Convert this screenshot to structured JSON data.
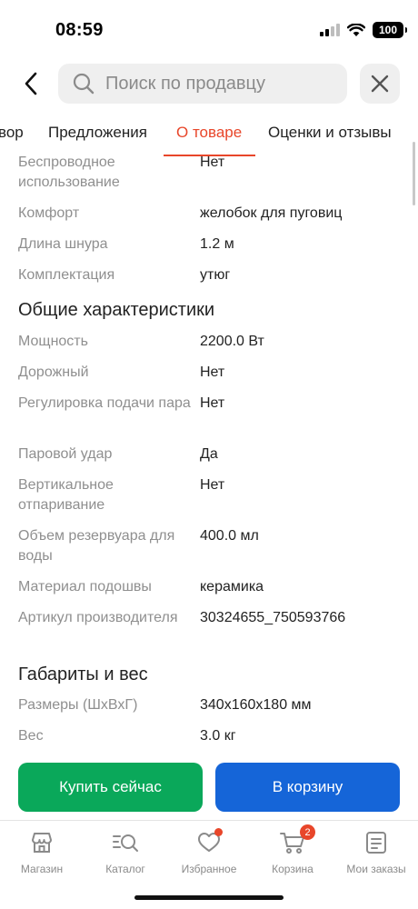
{
  "status": {
    "time": "08:59",
    "battery": "100"
  },
  "header": {
    "search_placeholder": "Поиск по продавцу"
  },
  "tabs": [
    {
      "label": "вор"
    },
    {
      "label": "Предложения"
    },
    {
      "label": "О товаре",
      "active": true
    },
    {
      "label": "Оценки и отзывы"
    }
  ],
  "specs_top": [
    {
      "key": "Беспроводное использование",
      "value": "Нет"
    },
    {
      "key": "Комфорт",
      "value": "желобок для пуговиц"
    },
    {
      "key": "Длина шнура",
      "value": "1.2 м"
    },
    {
      "key": "Комплектация",
      "value": "утюг"
    }
  ],
  "section_general": {
    "title": "Общие характеристики",
    "rows": [
      {
        "key": "Мощность",
        "value": "2200.0 Вт"
      },
      {
        "key": "Дорожный",
        "value": "Нет"
      },
      {
        "key": "Регулировка подачи пара",
        "value": "Нет"
      },
      {
        "key": "Паровой удар",
        "value": "Да"
      },
      {
        "key": "Вертикальное отпаривание",
        "value": "Нет"
      },
      {
        "key": "Объем резервуара для воды",
        "value": "400.0 мл"
      },
      {
        "key": "Материал подошвы",
        "value": "керамика"
      },
      {
        "key": "Артикул производителя",
        "value": "30324655_750593766"
      }
    ]
  },
  "section_dimensions": {
    "title": "Габариты и вес",
    "rows": [
      {
        "key": "Размеры (ШхВхГ)",
        "value": "340x160x180 мм"
      },
      {
        "key": "Вес",
        "value": "3.0 кг"
      }
    ]
  },
  "actions": {
    "buy_label": "Купить сейчас",
    "cart_label": "В корзину"
  },
  "bottom_nav": [
    {
      "label": "Магазин",
      "icon": "store-icon"
    },
    {
      "label": "Каталог",
      "icon": "catalog-search-icon"
    },
    {
      "label": "Избранное",
      "icon": "heart-icon"
    },
    {
      "label": "Корзина",
      "icon": "cart-icon",
      "badge": "2"
    },
    {
      "label": "Мои заказы",
      "icon": "orders-icon"
    }
  ],
  "colors": {
    "accent": "#e8462a",
    "buy": "#0aa85a",
    "cart": "#1565d8"
  }
}
